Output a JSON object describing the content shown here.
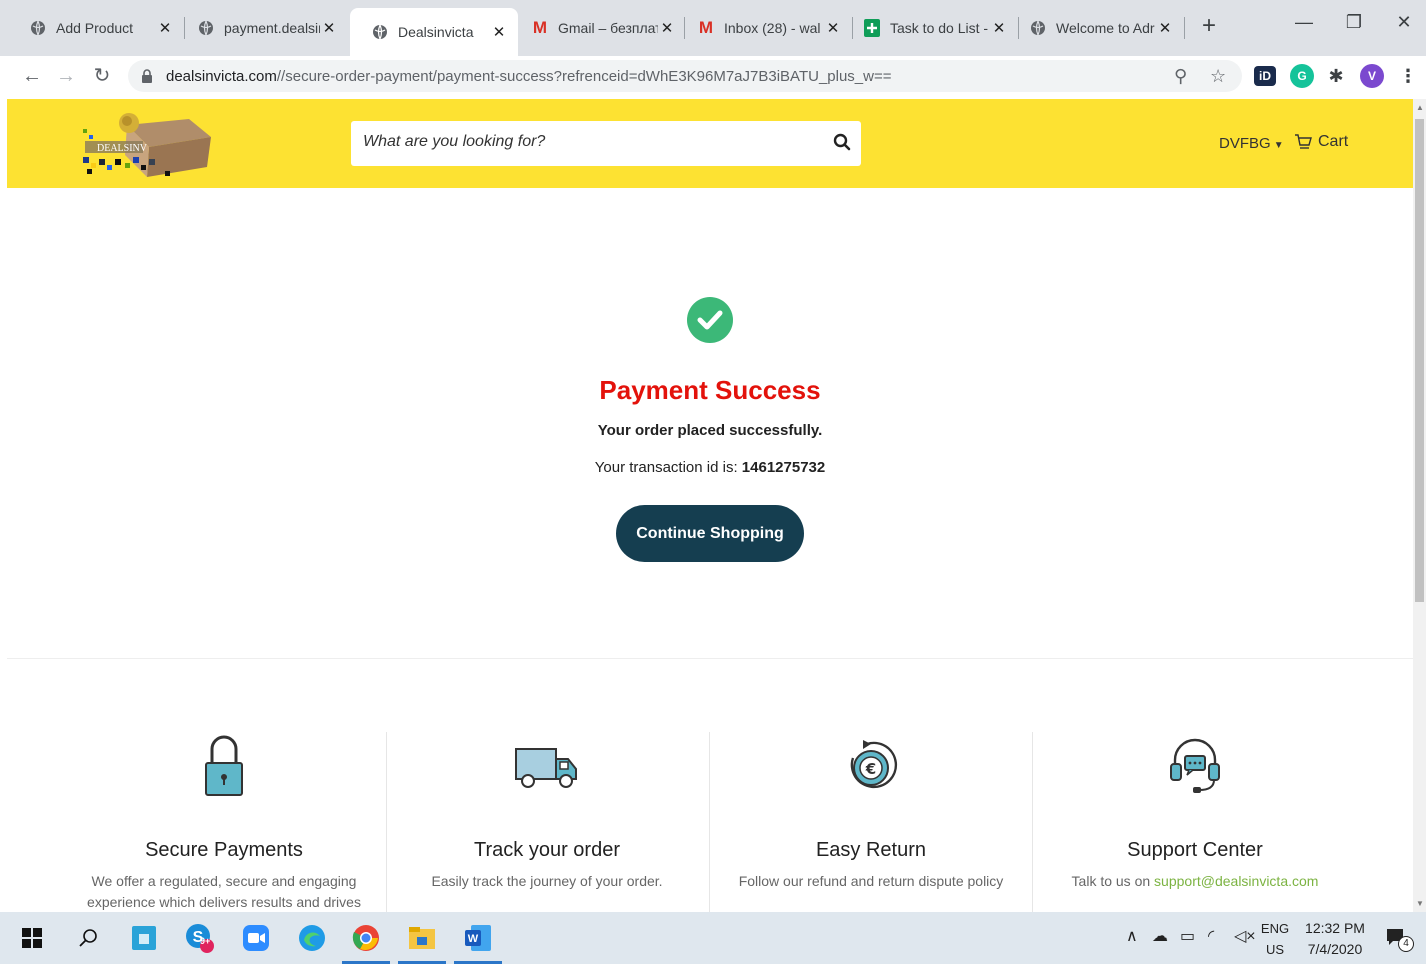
{
  "browser": {
    "tabs": [
      {
        "title": "Add Product",
        "favicon": "globe"
      },
      {
        "title": "payment.dealsin",
        "favicon": "globe"
      },
      {
        "title": "Dealsinvicta",
        "favicon": "globe"
      },
      {
        "title": "Gmail – безплат",
        "favicon": "gmail"
      },
      {
        "title": "Inbox (28) - wal",
        "favicon": "gmail"
      },
      {
        "title": "Task to do List -",
        "favicon": "sheets"
      },
      {
        "title": "Welcome to Adr",
        "favicon": "globe"
      }
    ],
    "active_tab_index": 2,
    "url_host": "dealsinvicta.com",
    "url_path": "//secure-order-payment/payment-success?refrenceid=dWhE3K96M7aJ7B3iBATU_plus_w==",
    "profile_initial": "V",
    "ext_id_label": "iD",
    "ext_grammarly_label": "G"
  },
  "header": {
    "search_placeholder": "What are you looking for?",
    "account_label": "DVFBG",
    "cart_label": "Cart"
  },
  "success": {
    "title": "Payment Success",
    "message": "Your order placed successfully.",
    "transaction_prefix": "Your transaction id is:",
    "transaction_id": "1461275732",
    "continue_label": "Continue Shopping"
  },
  "features": [
    {
      "title": "Secure Payments",
      "desc": "We offer a regulated, secure and engaging experience which delivers results and drives",
      "icon": "padlock-icon"
    },
    {
      "title": "Track your order",
      "desc": "Easily track the journey of your order.",
      "icon": "truck-icon"
    },
    {
      "title": "Easy Return",
      "desc": "Follow our refund and return dispute policy",
      "icon": "euro-return-icon"
    },
    {
      "title": "Support Center",
      "desc_prefix": "Talk to us on",
      "email": "support@dealsinvicta.com",
      "icon": "headset-icon"
    }
  ],
  "taskbar": {
    "lang_line1": "ENG",
    "lang_line2": "US",
    "time": "12:32 PM",
    "date": "7/4/2020",
    "skype_badge": "9+",
    "notification_count": "4"
  },
  "colors": {
    "header_yellow": "#fde232",
    "success_red": "#e3120b",
    "check_green": "#3cb878",
    "button_navy": "#153e50",
    "link_green": "#7cb342"
  }
}
